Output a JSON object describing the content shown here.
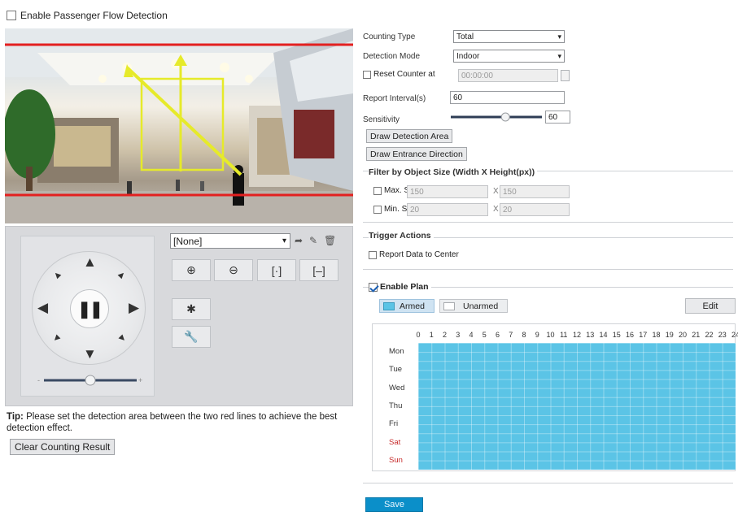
{
  "enable_passenger_flow": {
    "label": "Enable Passenger Flow Detection",
    "checked": false
  },
  "ptz": {
    "preset_value": "[None]",
    "zoom_level_fraction": 0.5
  },
  "tip": {
    "prefix": "Tip:",
    "text": " Please set the detection area between the two red lines to achieve the best detection effect."
  },
  "clear_button": "Clear Counting Result",
  "form": {
    "counting_type": {
      "label": "Counting Type",
      "value": "Total"
    },
    "detection_mode": {
      "label": "Detection Mode",
      "value": "Indoor"
    },
    "reset_counter": {
      "label": "Reset Counter at",
      "value": "00:00:00",
      "checked": false
    },
    "report_interval": {
      "label": "Report Interval(s)",
      "value": "60"
    },
    "sensitivity": {
      "label": "Sensitivity",
      "value": "60",
      "level_fraction": 0.6
    },
    "draw_area_button": "Draw Detection Area",
    "draw_direction_button": "Draw Entrance Direction"
  },
  "filter": {
    "title": "Filter by Object Size (Width X Height(px))",
    "max_label": "Max. Size",
    "max_w": "150",
    "max_h": "150",
    "min_label": "Min. Size",
    "min_w": "20",
    "min_h": "20",
    "times": "X"
  },
  "trigger": {
    "title": "Trigger Actions",
    "report_label": "Report Data to Center"
  },
  "plan": {
    "enable_label": "Enable Plan",
    "armed_label": "Armed",
    "unarmed_label": "Unarmed",
    "edit_label": "Edit",
    "hours": [
      "0",
      "1",
      "2",
      "3",
      "4",
      "5",
      "6",
      "7",
      "8",
      "9",
      "10",
      "11",
      "12",
      "13",
      "14",
      "15",
      "16",
      "17",
      "18",
      "19",
      "20",
      "21",
      "22",
      "23",
      "24"
    ],
    "days": [
      "Mon",
      "Tue",
      "Wed",
      "Thu",
      "Fri",
      "Sat",
      "Sun"
    ],
    "weekend_color": "#c62828",
    "armed_color": "#5bc4e6"
  },
  "save_label": "Save"
}
